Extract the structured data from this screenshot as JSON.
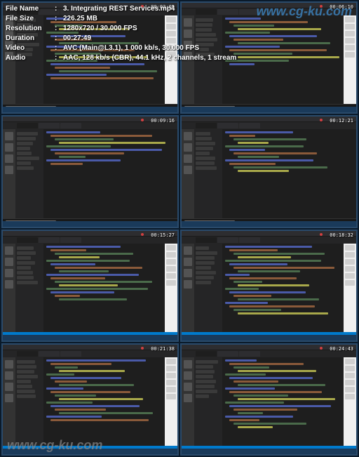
{
  "info": {
    "filename_label": "File Name",
    "filename_value": "3. Integrating REST Services.mp4",
    "filesize_label": "File Size",
    "filesize_value": "226.25 MB",
    "resolution_label": "Resolution",
    "resolution_value": "1280x720 / 30.000 FPS",
    "duration_label": "Duration",
    "duration_value": "00:27:49",
    "video_label": "Video",
    "video_value": "AVC (Main@L3.1), 1 000 kb/s, 30.000 FPS",
    "audio_label": "Audio",
    "audio_value": "AAC, 128 kb/s (CBR), 44.1 kHz, 2 channels, 1 stream"
  },
  "watermark": {
    "top": "www.cg-ku.com",
    "bottom": "www.cg-ku.com"
  },
  "thumbnails": [
    {
      "timestamp": "00:03:05",
      "lines": 18,
      "terminal": true,
      "panel": true
    },
    {
      "timestamp": "00:06:10",
      "lines": 14,
      "terminal": true,
      "panel": true
    },
    {
      "timestamp": "00:09:16",
      "lines": 10,
      "terminal": true,
      "panel": false
    },
    {
      "timestamp": "00:12:21",
      "lines": 12,
      "terminal": true,
      "panel": false
    },
    {
      "timestamp": "00:15:27",
      "lines": 16,
      "terminal": false,
      "panel": true
    },
    {
      "timestamp": "00:18:32",
      "lines": 20,
      "terminal": false,
      "panel": true
    },
    {
      "timestamp": "00:21:38",
      "lines": 18,
      "terminal": false,
      "panel": true
    },
    {
      "timestamp": "00:24:43",
      "lines": 20,
      "terminal": false,
      "panel": true
    }
  ],
  "colors": {
    "accent": "#007acc",
    "border": "#2a4a6a"
  }
}
